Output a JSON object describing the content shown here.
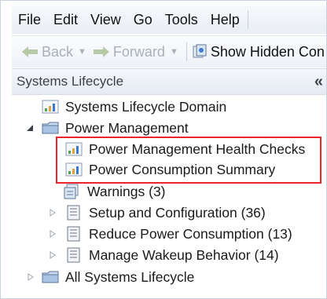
{
  "menubar": {
    "items": [
      "File",
      "Edit",
      "View",
      "Go",
      "Tools",
      "Help"
    ]
  },
  "toolbar": {
    "back_label": "Back",
    "forward_label": "Forward",
    "show_hidden_label": "Show Hidden Con"
  },
  "panel": {
    "title": "Systems Lifecycle",
    "collapse_glyph": "«"
  },
  "tree": {
    "domain": "Systems Lifecycle Domain",
    "power_management": "Power Management",
    "health_checks": "Power Management Health Checks",
    "consumption_summary": "Power Consumption Summary",
    "warnings": "Warnings (3)",
    "setup": "Setup and Configuration (36)",
    "reduce": "Reduce Power Consumption (13)",
    "wakeup": "Manage Wakeup Behavior (14)",
    "all_systems": "All Systems Lifecycle"
  },
  "colors": {
    "highlight_border": "#e8262c",
    "disabled_text": "#a9b0b8"
  }
}
